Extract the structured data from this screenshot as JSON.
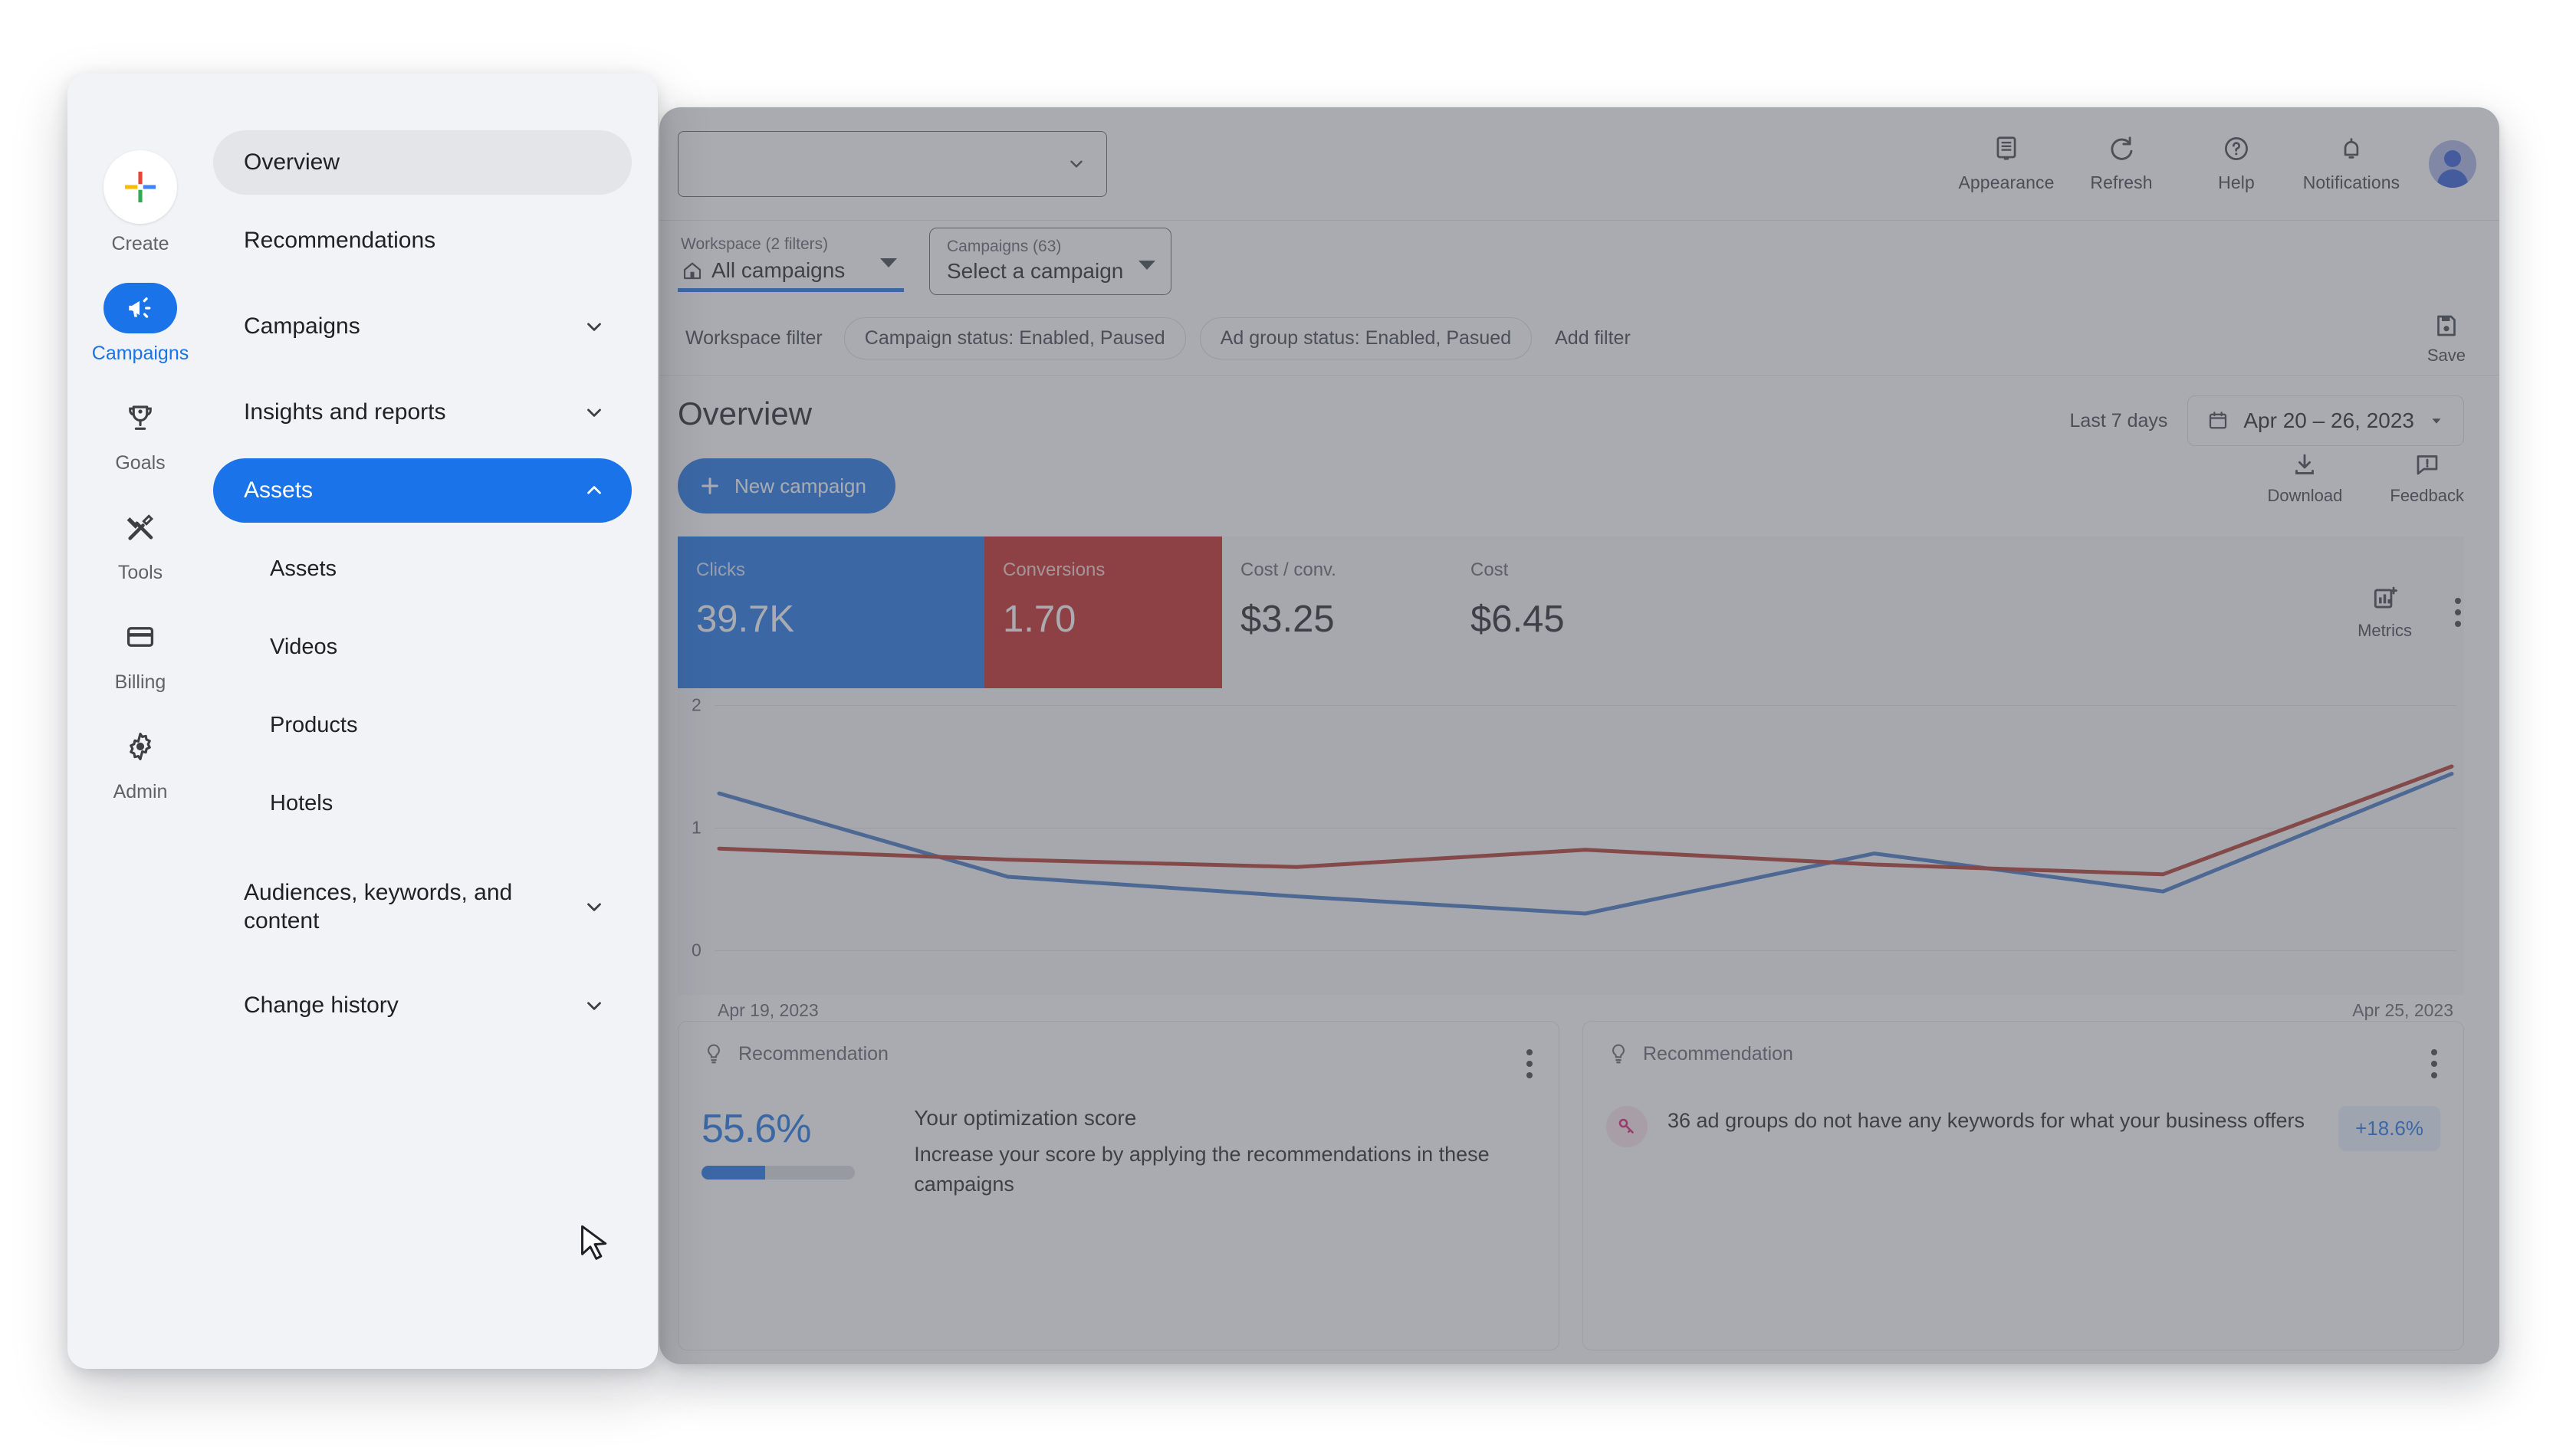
{
  "app": {
    "topbar": {
      "account_select_placeholder": "",
      "actions": [
        {
          "label": "Appearance",
          "icon": "appearance-icon"
        },
        {
          "label": "Refresh",
          "icon": "refresh-icon"
        },
        {
          "label": "Help",
          "icon": "help-icon"
        },
        {
          "label": "Notifications",
          "icon": "bell-icon"
        }
      ],
      "avatar": "user-avatar"
    },
    "selectors": {
      "workspace_caption": "Workspace (2 filters)",
      "workspace_value": "All campaigns",
      "campaigns_caption": "Campaigns (63)",
      "campaigns_value": "Select a campaign"
    },
    "filters": {
      "label": "Workspace filter",
      "chips": [
        "Campaign status: Enabled, Paused",
        "Ad group status: Enabled, Pasued"
      ],
      "add_filter": "Add filter",
      "save_label": "Save"
    },
    "page": {
      "title": "Overview",
      "new_campaign": "New campaign",
      "date_preset": "Last 7 days",
      "date_range": "Apr 20 – 26, 2023",
      "download": "Download",
      "feedback": "Feedback",
      "metrics_label": "Metrics"
    },
    "metrics": [
      {
        "label": "Clicks",
        "value": "39.7K",
        "state": "selected-blue",
        "color": "#1a73e8"
      },
      {
        "label": "Conversions",
        "value": "1.70",
        "state": "selected-red",
        "color": "#c5221f"
      },
      {
        "label": "Cost / conv.",
        "value": "$3.25",
        "state": "plain",
        "color": "#202124"
      },
      {
        "label": "Cost",
        "value": "$6.45",
        "state": "plain",
        "color": "#202124"
      }
    ],
    "recommendations": [
      {
        "header": "Recommendation",
        "score": "55.6%",
        "score_percent": 55.6,
        "heading": "Your optimization score",
        "body": "Increase your score by applying the recommendations in these campaigns"
      },
      {
        "header": "Recommendation",
        "icon": "keyword-icon",
        "body": "36 ad groups do not have any keywords for what your business offers",
        "badge": "+18.6%"
      }
    ]
  },
  "chart_data": {
    "type": "line",
    "title": "",
    "xlabel": "",
    "ylabel": "",
    "ylim": [
      0,
      2
    ],
    "yticks": [
      0,
      1,
      2
    ],
    "grid": true,
    "legend": "none",
    "x_tick_labels": [
      "Apr 19, 2023",
      "Apr 25, 2023"
    ],
    "x": [
      "Apr 19, 2023",
      "Apr 20, 2023",
      "Apr 21, 2023",
      "Apr 22, 2023",
      "Apr 23, 2023",
      "Apr 24, 2023",
      "Apr 25, 2023"
    ],
    "series": [
      {
        "name": "Clicks",
        "color": "#4274c5",
        "values": [
          1.28,
          0.6,
          0.44,
          0.3,
          0.79,
          0.48,
          1.44
        ]
      },
      {
        "name": "Conversions",
        "color": "#b13229",
        "values": [
          0.83,
          0.74,
          0.68,
          0.82,
          0.7,
          0.62,
          1.5
        ]
      }
    ]
  },
  "nav": {
    "rail": [
      {
        "label": "Create",
        "icon": "plus-multicolor-icon",
        "active": false
      },
      {
        "label": "Campaigns",
        "icon": "megaphone-icon",
        "active": true
      },
      {
        "label": "Goals",
        "icon": "trophy-icon",
        "active": false
      },
      {
        "label": "Tools",
        "icon": "tools-icon",
        "active": false
      },
      {
        "label": "Billing",
        "icon": "credit-card-icon",
        "active": false
      },
      {
        "label": "Admin",
        "icon": "gear-icon",
        "active": false
      }
    ],
    "menu": [
      {
        "label": "Overview",
        "state": "hover",
        "expandable": false,
        "sub": false
      },
      {
        "label": "Recommendations",
        "state": "normal",
        "expandable": false,
        "sub": false
      },
      {
        "label": "Campaigns",
        "state": "normal",
        "expandable": true,
        "expanded": false,
        "sub": false
      },
      {
        "label": "Insights and reports",
        "state": "normal",
        "expandable": true,
        "expanded": false,
        "sub": false
      },
      {
        "label": "Assets",
        "state": "selected",
        "expandable": true,
        "expanded": true,
        "sub": false
      },
      {
        "label": "Assets",
        "state": "normal",
        "expandable": false,
        "sub": true
      },
      {
        "label": "Videos",
        "state": "normal",
        "expandable": false,
        "sub": true
      },
      {
        "label": "Products",
        "state": "normal",
        "expandable": false,
        "sub": true
      },
      {
        "label": "Hotels",
        "state": "normal",
        "expandable": false,
        "sub": true
      },
      {
        "label": "Audiences, keywords, and content",
        "state": "normal",
        "expandable": true,
        "expanded": false,
        "sub": false,
        "two_line": true
      },
      {
        "label": "Change history",
        "state": "normal",
        "expandable": true,
        "expanded": false,
        "sub": false
      }
    ]
  }
}
